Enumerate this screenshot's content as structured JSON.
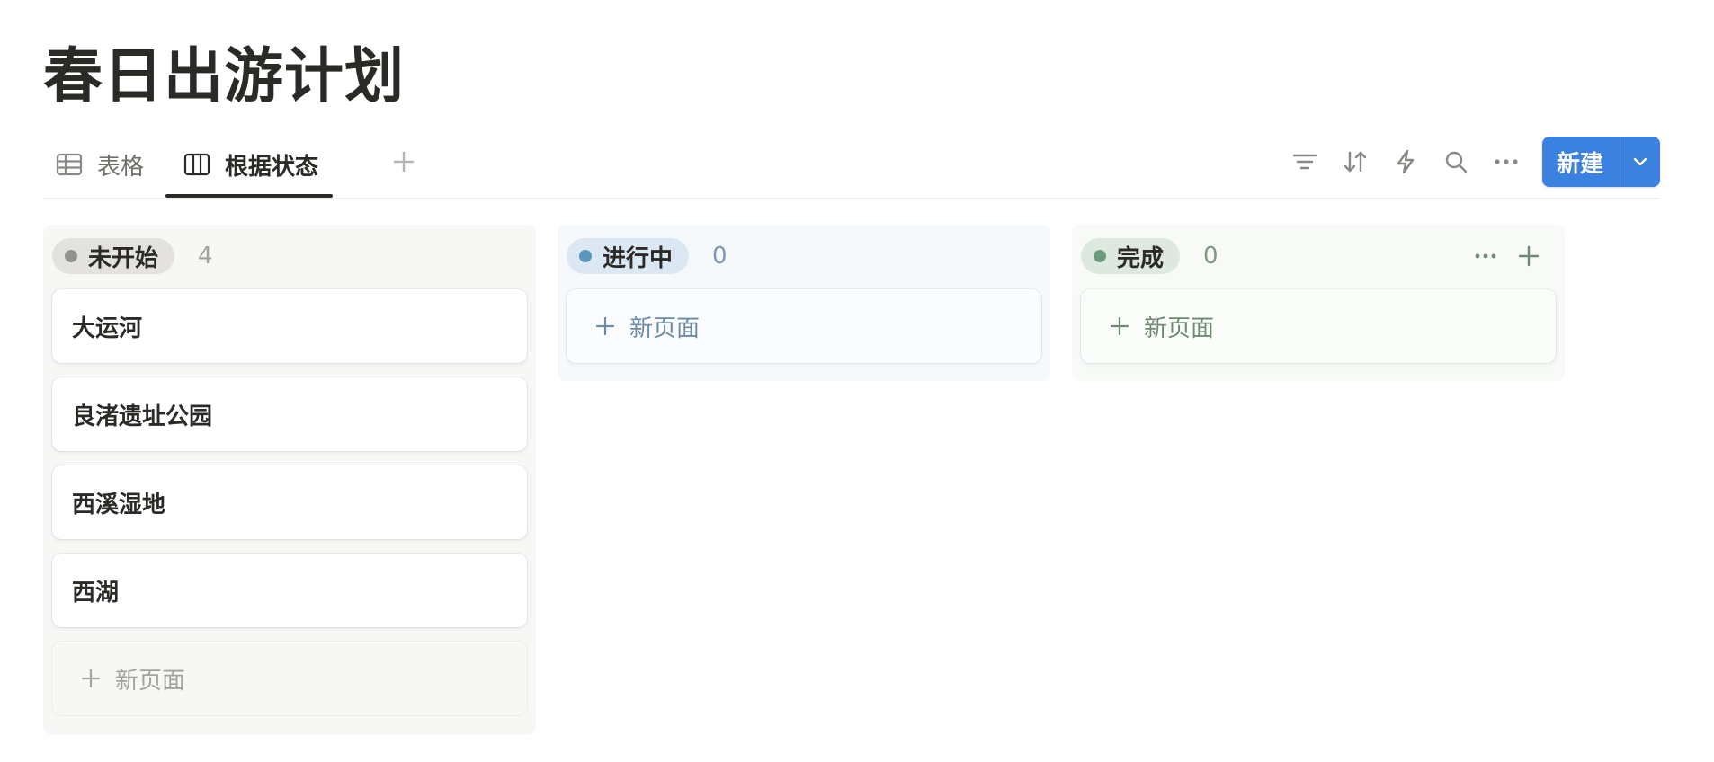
{
  "page": {
    "title": "春日出游计划"
  },
  "views": {
    "tabs": [
      {
        "label": "表格",
        "icon": "table-icon"
      },
      {
        "label": "根据状态",
        "icon": "board-icon",
        "active": true
      }
    ],
    "add_icon": "plus-icon"
  },
  "toolbar": {
    "icons": [
      "filter-icon",
      "sort-icon",
      "automation-icon",
      "search-icon",
      "more-icon"
    ],
    "new_label": "新建",
    "new_dropdown_icon": "chevron-down-icon"
  },
  "board": {
    "columns": [
      {
        "status": "未开始",
        "count": "4",
        "dot_color": "#91918e",
        "pill_bg": "#e3e2e0",
        "cards": [
          "大运河",
          "良渚遗址公园",
          "西溪湿地",
          "西湖"
        ],
        "add_label": "新页面"
      },
      {
        "status": "进行中",
        "count": "0",
        "dot_color": "#5b97bd",
        "pill_bg": "#dbe8f4",
        "cards": [],
        "add_label": "新页面"
      },
      {
        "status": "完成",
        "count": "0",
        "dot_color": "#6c9b7d",
        "pill_bg": "#dde9df",
        "cards": [],
        "add_label": "新页面"
      }
    ]
  },
  "colors": {
    "accent": "#3b82e0",
    "text": "#2b2a27"
  }
}
